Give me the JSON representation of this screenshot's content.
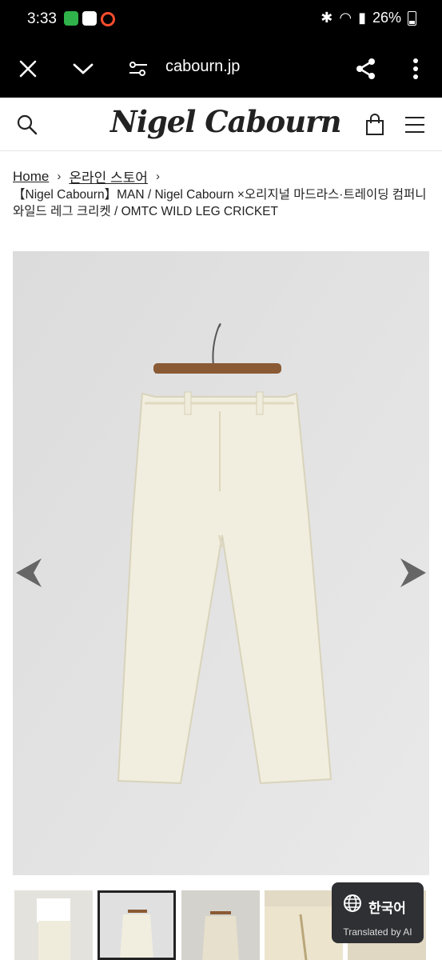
{
  "status_bar": {
    "time": "3:33",
    "battery": "26%"
  },
  "browser": {
    "url": "cabourn.jp"
  },
  "site": {
    "logo": "Nigel Cabourn"
  },
  "breadcrumb": {
    "home": "Home",
    "store": "온라인 스토어"
  },
  "product": {
    "title": "【Nigel Cabourn】MAN / Nigel Cabourn ×오리지널 마드라스·트레이딩 컴퍼니 와일드 레그 크리켓 / OMTC WILD LEG CRICKET"
  },
  "translate": {
    "lang": "한국어",
    "label": "Translated by AI"
  },
  "colors": {
    "status_bg": "#000000",
    "hero_bg": "#e2e2e2",
    "pants": "#f1eedf",
    "translate_bg": "#2f3034"
  },
  "icons": [
    "close-icon",
    "chevron-down-icon",
    "tune-icon",
    "share-icon",
    "more-vert-icon",
    "search-icon",
    "bag-icon",
    "menu-icon",
    "prev-arrow-icon",
    "next-arrow-icon",
    "globe-icon"
  ]
}
